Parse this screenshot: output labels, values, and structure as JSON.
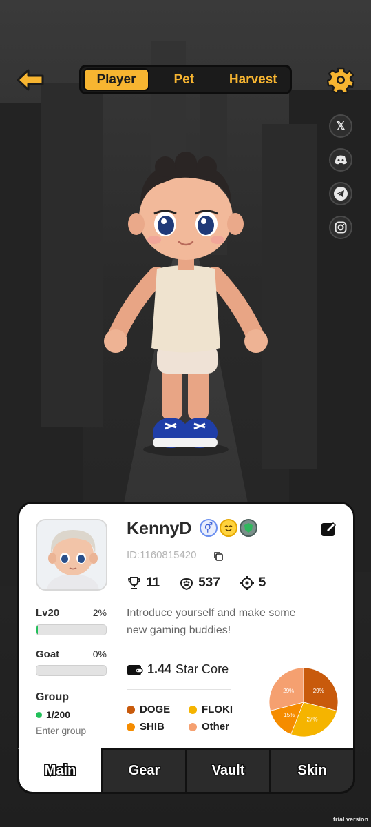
{
  "top_tabs": [
    {
      "label": "Player",
      "active": true
    },
    {
      "label": "Pet",
      "active": false
    },
    {
      "label": "Harvest",
      "active": false
    }
  ],
  "social": [
    "x-icon",
    "discord-icon",
    "telegram-icon",
    "instagram-icon"
  ],
  "profile": {
    "username": "KennyD",
    "id": "ID:1160815420",
    "stats": {
      "trophies": "11",
      "paws": "537",
      "targets": "5"
    },
    "intro": "Introduce yourself and make some new gaming buddies!",
    "level": {
      "label": "Lv20",
      "pct": "2%",
      "fill": 0.02
    },
    "goat": {
      "label": "Goat",
      "pct": "0%",
      "fill": 0
    },
    "group": {
      "label": "Group",
      "count": "1/200",
      "placeholder": "Enter group"
    },
    "wallet": {
      "amount": "1.44",
      "unit": "Star Core"
    }
  },
  "holdings": {
    "legend": [
      {
        "label": "DOGE",
        "color": "#c85a0c"
      },
      {
        "label": "FLOKI",
        "color": "#f5b400"
      },
      {
        "label": "SHIB",
        "color": "#f58c00"
      },
      {
        "label": "Other",
        "color": "#f5a070"
      }
    ]
  },
  "chart_data": {
    "type": "pie",
    "categories": [
      "DOGE",
      "FLOKI",
      "SHIB",
      "Other"
    ],
    "values": [
      29,
      27,
      15,
      29
    ],
    "labels": [
      "29%",
      "27%",
      "15%",
      "29%"
    ]
  },
  "bottom_tabs": [
    {
      "label": "Main",
      "active": true
    },
    {
      "label": "Gear",
      "active": false
    },
    {
      "label": "Vault",
      "active": false
    },
    {
      "label": "Skin",
      "active": false
    }
  ],
  "watermark": "trial version",
  "colors": {
    "accent": "#f7b531",
    "green": "#22c05a"
  }
}
